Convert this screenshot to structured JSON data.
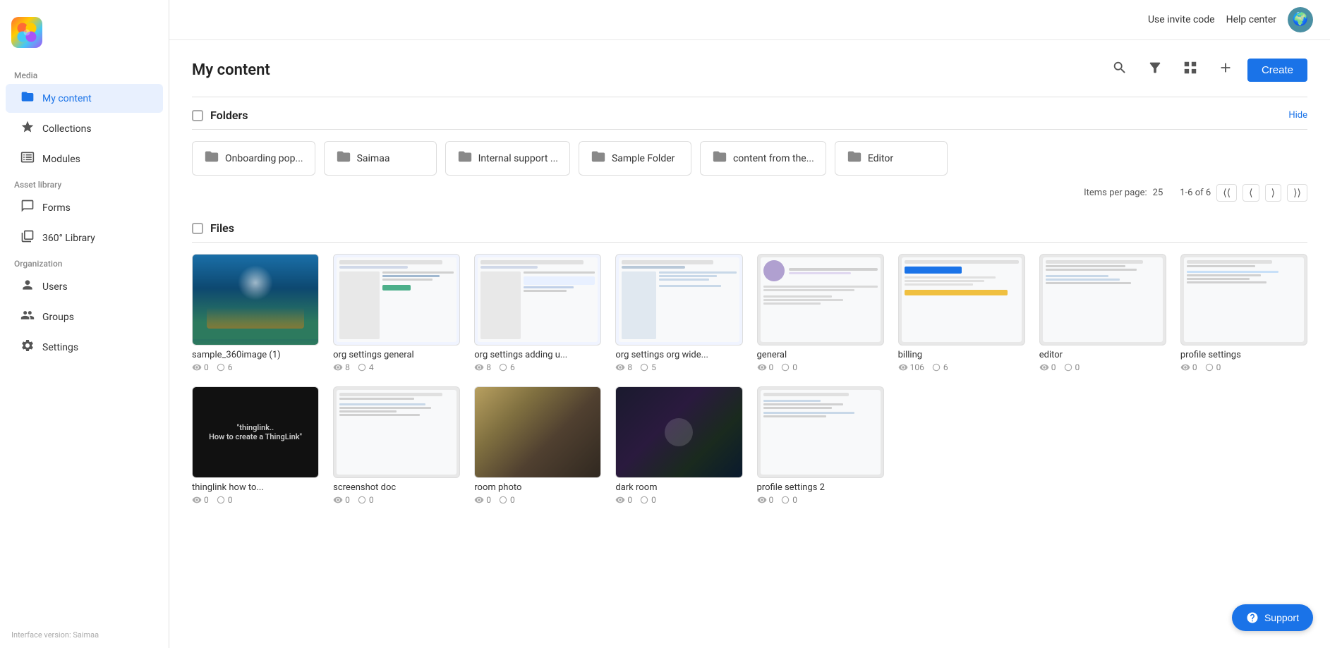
{
  "app": {
    "logo_emoji": "🎨",
    "version_label": "Interface version: Saimaa"
  },
  "topbar": {
    "use_invite_code": "Use invite code",
    "help_center": "Help center",
    "avatar_emoji": "🌍"
  },
  "sidebar": {
    "media_label": "Media",
    "items_media": [
      {
        "id": "my-content",
        "label": "My content",
        "icon": "📁",
        "active": true
      },
      {
        "id": "collections",
        "label": "Collections",
        "icon": "⭐"
      },
      {
        "id": "modules",
        "label": "Modules",
        "icon": "📺"
      }
    ],
    "asset_library_label": "Asset library",
    "items_asset": [
      {
        "id": "forms",
        "label": "Forms",
        "icon": "💬"
      },
      {
        "id": "360-library",
        "label": "360° Library",
        "icon": "📊"
      }
    ],
    "organization_label": "Organization",
    "items_org": [
      {
        "id": "users",
        "label": "Users",
        "icon": "👤"
      },
      {
        "id": "groups",
        "label": "Groups",
        "icon": "👥"
      },
      {
        "id": "settings",
        "label": "Settings",
        "icon": "⚙️"
      }
    ]
  },
  "main": {
    "title": "My content",
    "create_label": "Create",
    "folders_section_title": "Folders",
    "hide_label": "Hide",
    "folders": [
      {
        "id": "onboarding",
        "name": "Onboarding pop..."
      },
      {
        "id": "saimaa",
        "name": "Saimaa"
      },
      {
        "id": "internal-support",
        "name": "Internal support ..."
      },
      {
        "id": "sample-folder",
        "name": "Sample Folder"
      },
      {
        "id": "content-from",
        "name": "content from the..."
      },
      {
        "id": "editor",
        "name": "Editor"
      }
    ],
    "pagination": {
      "items_per_page_label": "Items per page:",
      "items_per_page": "25",
      "range_label": "1-6 of 6"
    },
    "files_section_title": "Files",
    "files": [
      {
        "id": "sample-360",
        "name": "sample_360image (1)",
        "thumb_type": "ocean",
        "stat1_icon": "👁",
        "stat1_val": "0",
        "stat2_icon": "○",
        "stat2_val": "6"
      },
      {
        "id": "org-settings-general",
        "name": "org settings general",
        "thumb_type": "screenshot",
        "stat1_icon": "👁",
        "stat1_val": "8",
        "stat2_icon": "○",
        "stat2_val": "4"
      },
      {
        "id": "org-settings-adding",
        "name": "org settings adding u...",
        "thumb_type": "screenshot",
        "stat1_icon": "👁",
        "stat1_val": "8",
        "stat2_icon": "○",
        "stat2_val": "6"
      },
      {
        "id": "org-settings-orgwide",
        "name": "org settings org wide...",
        "thumb_type": "screenshot",
        "stat1_icon": "👁",
        "stat1_val": "8",
        "stat2_icon": "○",
        "stat2_val": "5"
      },
      {
        "id": "general",
        "name": "general",
        "thumb_type": "screenshot",
        "stat1_icon": "👁",
        "stat1_val": "0",
        "stat2_icon": "○",
        "stat2_val": "0"
      },
      {
        "id": "billing",
        "name": "billing",
        "thumb_type": "screenshot",
        "stat1_icon": "👁",
        "stat1_val": "106",
        "stat2_icon": "○",
        "stat2_val": "6"
      },
      {
        "id": "editor",
        "name": "editor",
        "thumb_type": "screenshot-light",
        "stat1_icon": "👁",
        "stat1_val": "0",
        "stat2_icon": "○",
        "stat2_val": "0"
      },
      {
        "id": "profile-settings",
        "name": "profile settings",
        "thumb_type": "screenshot",
        "stat1_icon": "👁",
        "stat1_val": "0",
        "stat2_icon": "○",
        "stat2_val": "0"
      },
      {
        "id": "thinglink-how",
        "name": "thinglink how to...",
        "thumb_type": "dark",
        "thumb_text": "\"thinglink.. How to create a ThingLink\"",
        "stat1_icon": "👁",
        "stat1_val": "0",
        "stat2_icon": "○",
        "stat2_val": "0"
      },
      {
        "id": "screenshot-doc",
        "name": "screenshot doc",
        "thumb_type": "screenshot",
        "stat1_icon": "👁",
        "stat1_val": "0",
        "stat2_icon": "○",
        "stat2_val": "0"
      },
      {
        "id": "room-photo",
        "name": "room photo",
        "thumb_type": "room",
        "stat1_icon": "👁",
        "stat1_val": "0",
        "stat2_icon": "○",
        "stat2_val": "0"
      },
      {
        "id": "dark-room",
        "name": "dark room",
        "thumb_type": "darkroom",
        "stat1_icon": "👁",
        "stat1_val": "0",
        "stat2_icon": "○",
        "stat2_val": "0"
      },
      {
        "id": "profile-settings-2",
        "name": "profile settings 2",
        "thumb_type": "screenshot",
        "stat1_icon": "👁",
        "stat1_val": "0",
        "stat2_icon": "○",
        "stat2_val": "0"
      }
    ]
  },
  "support_label": "Support"
}
